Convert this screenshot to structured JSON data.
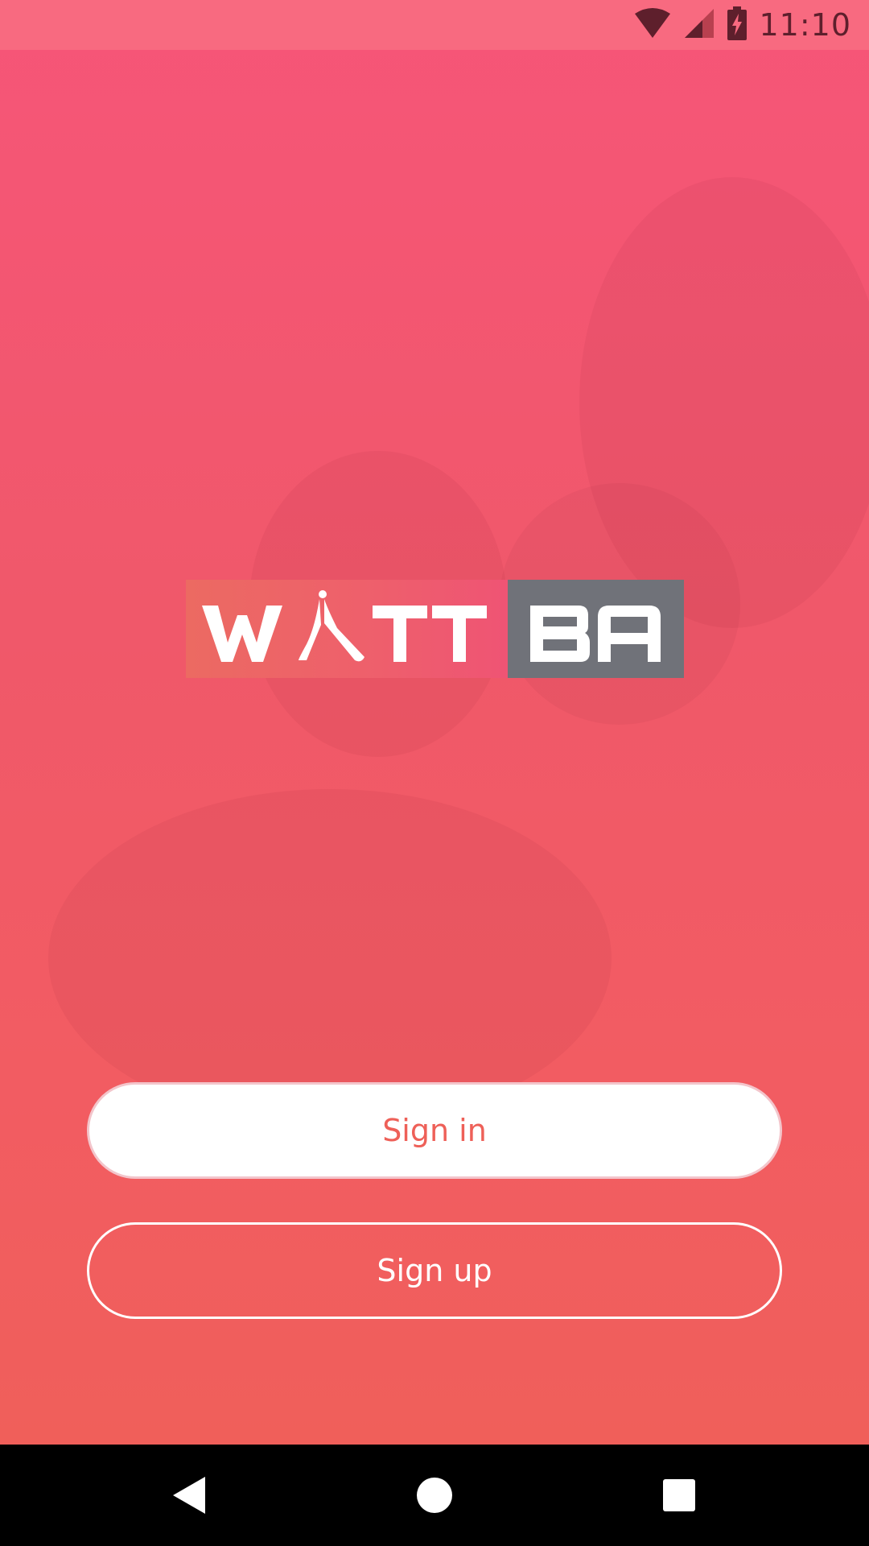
{
  "status_bar": {
    "time": "11:10",
    "icons": [
      "wifi-icon",
      "signal-icon",
      "battery-charging-icon"
    ]
  },
  "logo": {
    "text": "WATTBA",
    "colors": {
      "left_gradient_start": "#ec6a62",
      "left_gradient_end": "#ef5474",
      "right_box": "#707279"
    }
  },
  "buttons": {
    "sign_in": "Sign in",
    "sign_up": "Sign up"
  },
  "nav_bar": {
    "icons": [
      "back-icon",
      "home-icon",
      "recents-icon"
    ]
  },
  "theme": {
    "accent": "#ee6058",
    "background_top": "#f65578",
    "background_bottom": "#ef6058"
  }
}
